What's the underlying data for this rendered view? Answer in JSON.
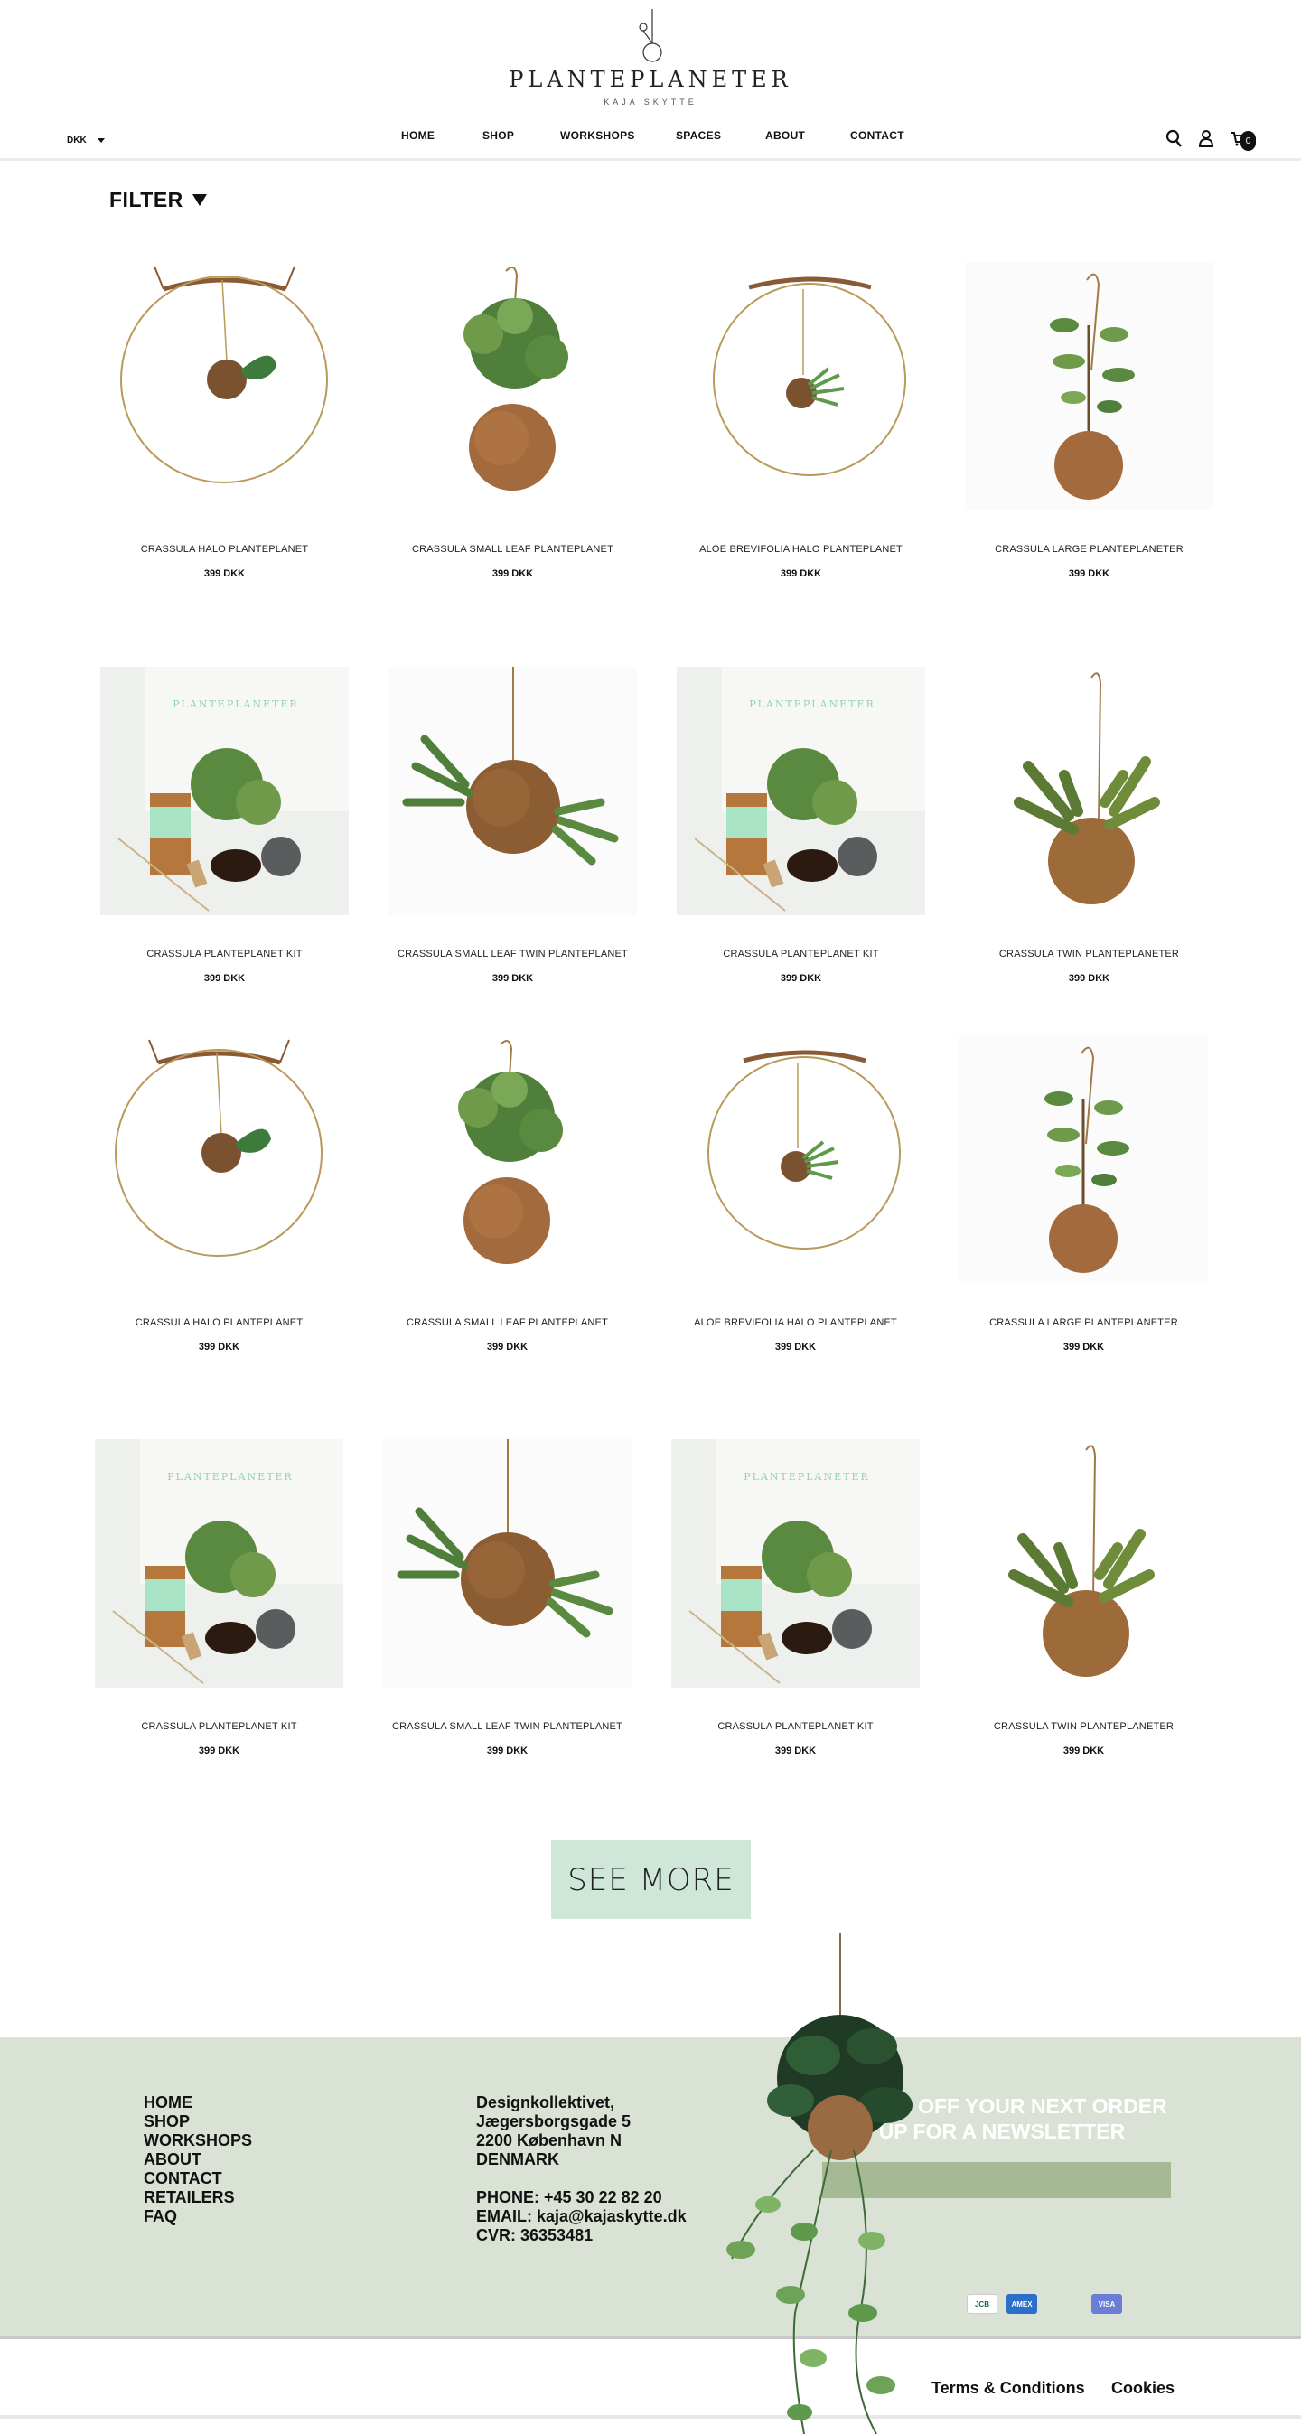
{
  "brand": {
    "title": "PLANTEPLANETER",
    "subtitle": "KAJA SKYTTE"
  },
  "currency": {
    "value": "DKK"
  },
  "nav": [
    "HOME",
    "SHOP",
    "WORKSHOPS",
    "SPACES",
    "ABOUT",
    "CONTACT"
  ],
  "cart": {
    "count": "0"
  },
  "icons": {
    "search": "search-icon",
    "account": "user-icon",
    "cart": "cart-icon"
  },
  "filter": {
    "label": "FILTER"
  },
  "products": [
    {
      "name": "CRASSULA HALO PLANTEPLANET",
      "price": "399 DKK",
      "image": "halo"
    },
    {
      "name": "CRASSULA SMALL LEAF PLANTEPLANET",
      "price": "399 DKK",
      "image": "ball-plant"
    },
    {
      "name": "ALOE BREVIFOLIA HALO PLANTEPLANET",
      "price": "399 DKK",
      "image": "halo-aloe"
    },
    {
      "name": "CRASSULA LARGE PLANTEPLANETER",
      "price": "399 DKK",
      "image": "tall-plant"
    },
    {
      "name": "CRASSULA PLANTEPLANET KIT",
      "price": "399 DKK",
      "image": "kit"
    },
    {
      "name": "CRASSULA SMALL LEAF TWIN PLANTEPLANET",
      "price": "399 DKK",
      "image": "twin"
    },
    {
      "name": "CRASSULA PLANTEPLANET KIT",
      "price": "399 DKK",
      "image": "kit"
    },
    {
      "name": "CRASSULA TWIN PLANTEPLANETER",
      "price": "399 DKK",
      "image": "twin-large"
    },
    {
      "name": "CRASSULA HALO PLANTEPLANET",
      "price": "399 DKK",
      "image": "halo"
    },
    {
      "name": "CRASSULA SMALL LEAF PLANTEPLANET",
      "price": "399 DKK",
      "image": "ball-plant"
    },
    {
      "name": "ALOE BREVIFOLIA HALO PLANTEPLANET",
      "price": "399 DKK",
      "image": "halo-aloe"
    },
    {
      "name": "CRASSULA LARGE PLANTEPLANETER",
      "price": "399 DKK",
      "image": "tall-plant"
    },
    {
      "name": "CRASSULA PLANTEPLANET KIT",
      "price": "399 DKK",
      "image": "kit"
    },
    {
      "name": "CRASSULA SMALL LEAF TWIN PLANTEPLANET",
      "price": "399 DKK",
      "image": "twin"
    },
    {
      "name": "CRASSULA PLANTEPLANET KIT",
      "price": "399 DKK",
      "image": "kit"
    },
    {
      "name": "CRASSULA TWIN PLANTEPLANETER",
      "price": "399 DKK",
      "image": "twin-large"
    }
  ],
  "see_more": "SEE MORE",
  "footer": {
    "links": [
      "HOME",
      "SHOP",
      "WORKSHOPS",
      "ABOUT",
      "CONTACT",
      "RETAILERS",
      "FAQ"
    ],
    "address": [
      "Designkollektivet,",
      "Jægersborgsgade 5",
      "2200 København N",
      "DENMARK"
    ],
    "contact": [
      "PHONE: +45 30 22 82 20",
      "EMAIL: kaja@kajaskytte.dk",
      "CVR: 36353481"
    ],
    "newsletter": [
      "GET 10% OFF YOUR NEXT ORDER",
      "SIGN UP FOR A NEWSLETTER"
    ],
    "payments": [
      "JCB",
      "AMEX",
      "VISA"
    ]
  },
  "bottom": {
    "terms": "Terms & Conditions",
    "cookies": "Cookies"
  },
  "colors": {
    "mint": "#cfe7d9",
    "footer": "#d9e2d5",
    "input": "#a5b994"
  }
}
